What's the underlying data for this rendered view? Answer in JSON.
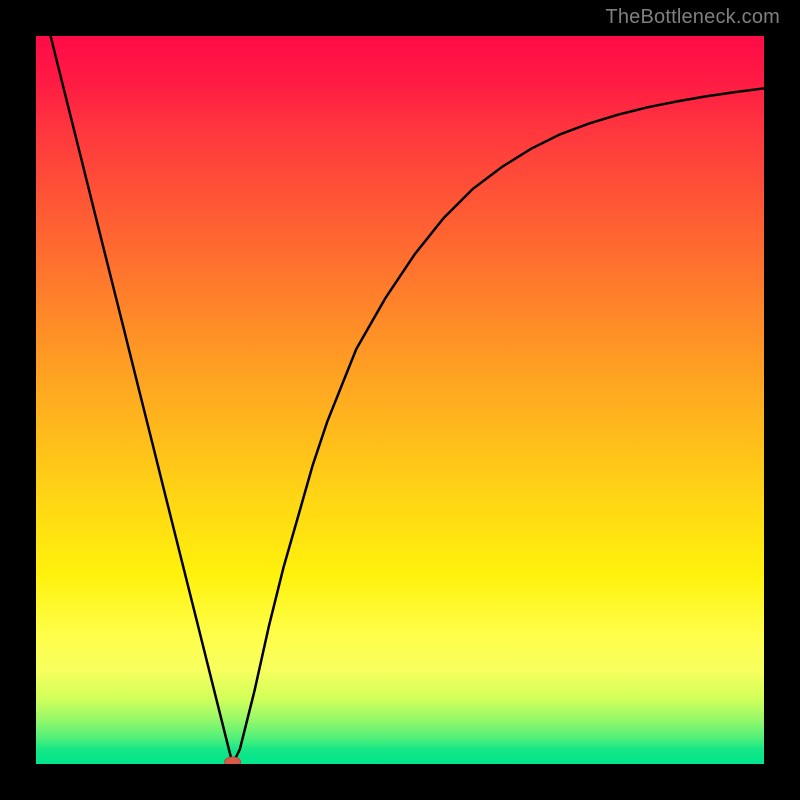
{
  "watermark": {
    "text": "TheBottleneck.com"
  },
  "chart_data": {
    "type": "line",
    "title": "",
    "xlabel": "",
    "ylabel": "",
    "xlim": [
      0,
      100
    ],
    "ylim": [
      0,
      100
    ],
    "grid": false,
    "legend": false,
    "series": [
      {
        "name": "bottleneck-curve",
        "x": [
          2,
          4,
          6,
          8,
          10,
          12,
          14,
          16,
          18,
          20,
          22,
          24,
          26,
          27,
          28,
          30,
          32,
          34,
          36,
          38,
          40,
          44,
          48,
          52,
          56,
          60,
          64,
          68,
          72,
          76,
          80,
          84,
          88,
          92,
          96,
          100
        ],
        "y": [
          100,
          92,
          84,
          76,
          68,
          60,
          52,
          44,
          36,
          28,
          20,
          12,
          4,
          0,
          2,
          10,
          19,
          27,
          34,
          41,
          47,
          57,
          64,
          70,
          75,
          79,
          82,
          84.5,
          86.5,
          88,
          89.2,
          90.2,
          91,
          91.7,
          92.3,
          92.8
        ]
      }
    ],
    "markers": [
      {
        "name": "min-point",
        "x": 27,
        "y": 0,
        "color": "#d85a4a",
        "size": 6
      }
    ],
    "background_gradient": {
      "type": "vertical",
      "stops": [
        {
          "pos": 0.0,
          "color": "#ff0b47"
        },
        {
          "pos": 0.24,
          "color": "#ff5a34"
        },
        {
          "pos": 0.54,
          "color": "#ffb91c"
        },
        {
          "pos": 0.74,
          "color": "#fff20c"
        },
        {
          "pos": 0.91,
          "color": "#d2ff5a"
        },
        {
          "pos": 1.0,
          "color": "#00e58d"
        }
      ]
    }
  }
}
